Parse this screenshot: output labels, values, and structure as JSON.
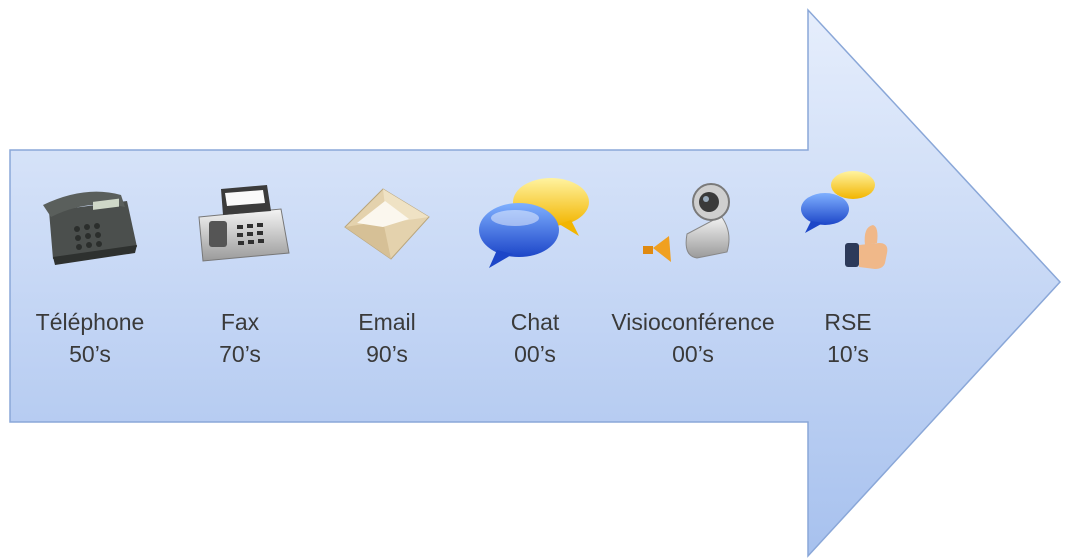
{
  "colors": {
    "arrow_light": "#e3ecfb",
    "arrow_dark": "#a9c3ef",
    "arrow_edge": "#8aa7d8",
    "text": "#3a3a3a"
  },
  "timeline": {
    "items": [
      {
        "name": "Téléphone",
        "era": "50’s",
        "icon": "telephone-icon"
      },
      {
        "name": "Fax",
        "era": "70’s",
        "icon": "fax-icon"
      },
      {
        "name": "Email",
        "era": "90’s",
        "icon": "envelope-icon"
      },
      {
        "name": "Chat",
        "era": "00’s",
        "icon": "chat-bubbles-icon"
      },
      {
        "name": "Visioconférence",
        "era": "00’s",
        "icon": "webcam-icon"
      },
      {
        "name": "RSE",
        "era": "10’s",
        "icon": "social-network-icon"
      }
    ]
  }
}
